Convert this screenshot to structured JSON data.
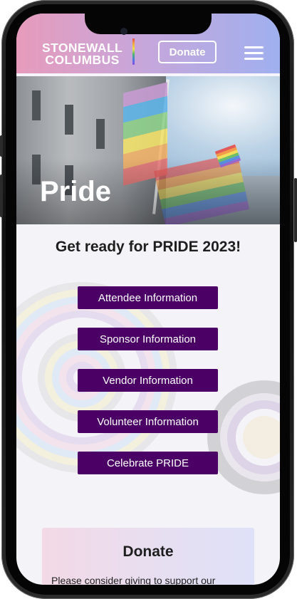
{
  "header": {
    "logo_line1": "STONEWALL",
    "logo_line2": "COLUMBUS",
    "donate_label": "Donate"
  },
  "hero": {
    "title": "Pride"
  },
  "main": {
    "heading": "Get ready for PRIDE 2023!",
    "links": [
      {
        "label": "Attendee Information"
      },
      {
        "label": "Sponsor Information"
      },
      {
        "label": "Vendor Information"
      },
      {
        "label": "Volunteer Information"
      },
      {
        "label": "Celebrate PRIDE"
      }
    ]
  },
  "donate_section": {
    "title": "Donate",
    "text": "Please consider giving to support our"
  },
  "colors": {
    "button_bg": "#4b0066",
    "header_gradient_start": "#e79bbb",
    "header_gradient_end": "#9fb0ef"
  }
}
